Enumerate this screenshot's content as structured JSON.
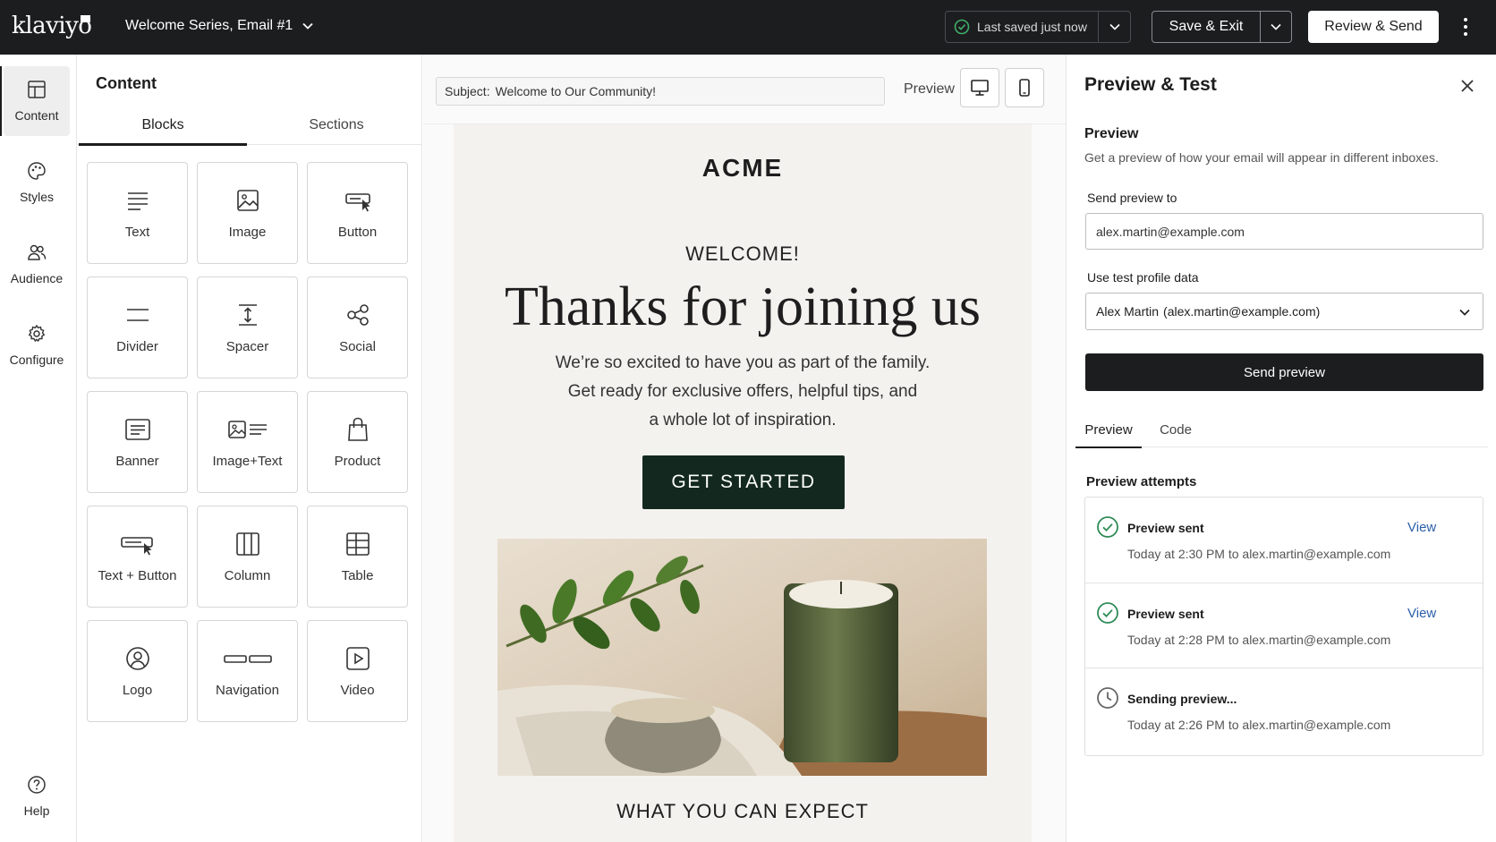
{
  "topbar": {
    "logo": "klaviyo",
    "doc_title": "Welcome Series, Email #1",
    "save_status": "Last saved just now",
    "save_exit_label": "Save & Exit",
    "review_send_label": "Review & Send"
  },
  "rail": {
    "items": [
      {
        "label": "Content",
        "icon": "layout-icon",
        "active": true
      },
      {
        "label": "Styles",
        "icon": "palette-icon"
      },
      {
        "label": "Audience",
        "icon": "users-icon"
      },
      {
        "label": "Configure",
        "icon": "gear-icon"
      }
    ],
    "help_label": "Help"
  },
  "content_panel": {
    "title": "Content",
    "tabs": [
      "Blocks",
      "Sections"
    ],
    "active_tab": "Blocks",
    "blocks": [
      {
        "label": "Text",
        "icon": "text-icon"
      },
      {
        "label": "Image",
        "icon": "image-icon"
      },
      {
        "label": "Button",
        "icon": "button-icon"
      },
      {
        "label": "Divider",
        "icon": "divider-icon"
      },
      {
        "label": "Spacer",
        "icon": "spacer-icon"
      },
      {
        "label": "Social",
        "icon": "social-icon"
      },
      {
        "label": "Banner",
        "icon": "banner-icon"
      },
      {
        "label": "Image+Text",
        "icon": "image-text-icon"
      },
      {
        "label": "Product",
        "icon": "product-icon"
      },
      {
        "label": "Text + Button",
        "icon": "text-button-icon"
      },
      {
        "label": "Column",
        "icon": "column-icon"
      },
      {
        "label": "Table",
        "icon": "table-icon"
      },
      {
        "label": "Logo",
        "icon": "logo-icon"
      },
      {
        "label": "Navigation",
        "icon": "navigation-icon"
      },
      {
        "label": "Video",
        "icon": "video-icon"
      }
    ]
  },
  "canvas": {
    "subject_label": "Subject:",
    "subject_value": "Welcome to Our Community!",
    "preview_label": "Preview",
    "email": {
      "brand": "ACME",
      "eyebrow": "WELCOME!",
      "headline": "Thanks for joining us",
      "body_lines": [
        "We’re so excited to have you as part of the family.",
        "Get ready for exclusive offers, helpful tips, and",
        "a whole lot of inspiration."
      ],
      "cta_label": "GET STARTED",
      "section_heading": "WHAT YOU CAN EXPECT"
    }
  },
  "preview_panel": {
    "title": "Preview & Test",
    "preview_heading": "Preview",
    "preview_desc": "Get a preview of how your email will appear in different inboxes.",
    "send_to_label": "Send preview to",
    "send_to_value": "alex.martin@example.com",
    "profile_label": "Use test profile data",
    "profile_name": "Alex Martin",
    "profile_email": "(alex.martin@example.com)",
    "send_button": "Send preview",
    "tabs": [
      "Preview",
      "Code"
    ],
    "attempts_heading": "Preview attempts",
    "attempts": [
      {
        "title": "Preview sent",
        "time": "Today at 2:30 PM",
        "recipient": "to alex.martin@example.com",
        "status": "sent",
        "action": "View"
      },
      {
        "title": "Preview sent",
        "time": "Today at 2:28 PM",
        "recipient": "to alex.martin@example.com",
        "status": "sent",
        "action": "View"
      },
      {
        "title": "Sending preview...",
        "time": "Today at 2:26 PM",
        "recipient": "to alex.martin@example.com",
        "status": "pending",
        "action": ""
      }
    ]
  },
  "colors": {
    "topbar_bg": "#1c1d1f",
    "cta_bg": "#13291f",
    "success_green": "#2e8b57",
    "link_blue": "#2b5fa8"
  }
}
